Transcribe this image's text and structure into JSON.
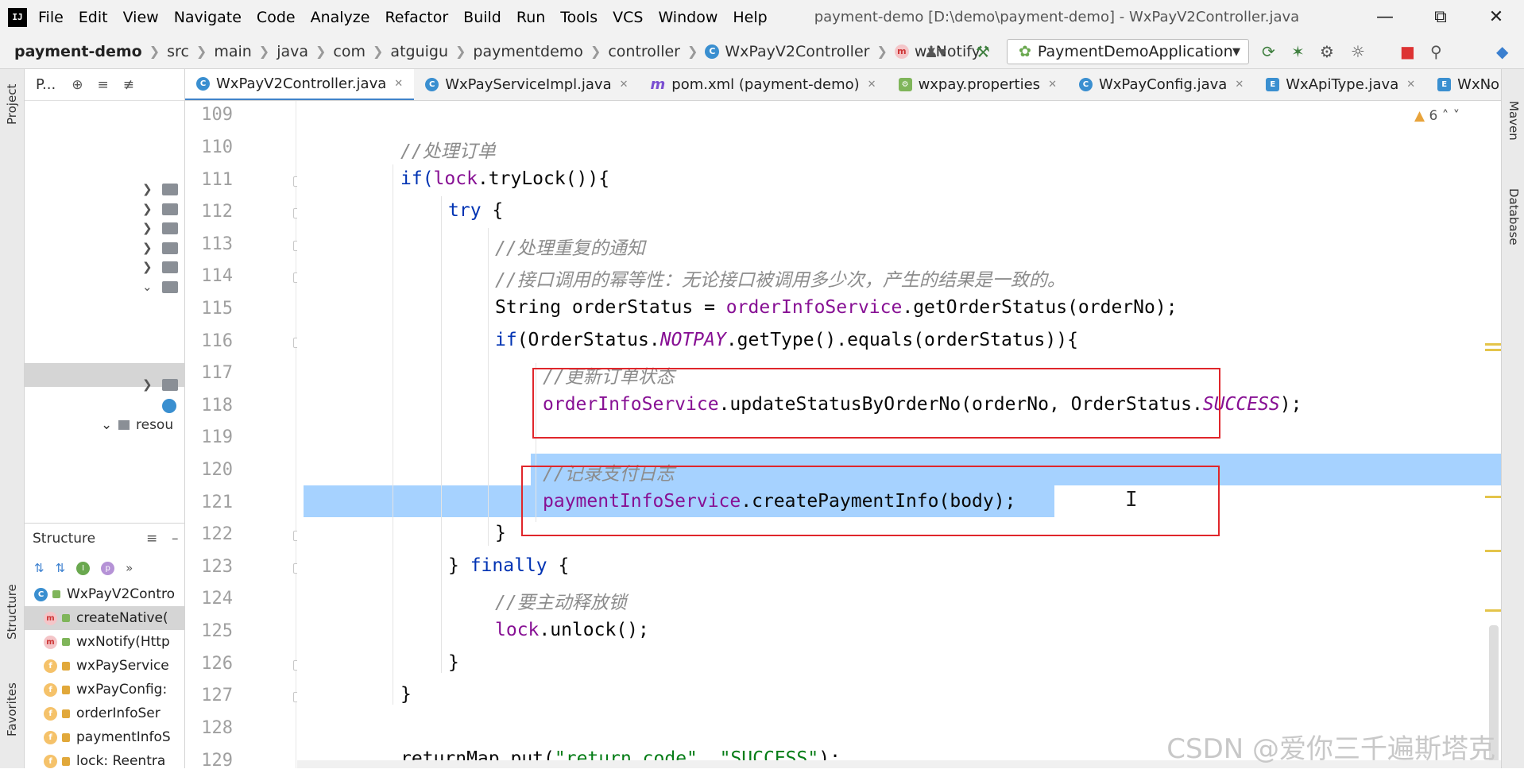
{
  "app": {
    "logo": "IJ",
    "menu": [
      "File",
      "Edit",
      "View",
      "Navigate",
      "Code",
      "Analyze",
      "Refactor",
      "Build",
      "Run",
      "Tools",
      "VCS",
      "Window",
      "Help"
    ],
    "title": "payment-demo [D:\\demo\\payment-demo] - WxPayV2Controller.java"
  },
  "breadcrumb": [
    "payment-demo",
    "src",
    "main",
    "java",
    "com",
    "atguigu",
    "paymentdemo",
    "controller",
    "WxPayV2Controller",
    "wxNotify"
  ],
  "run_config": "PaymentDemoApplication",
  "side": {
    "left_top": "Project",
    "left_mid": "Structure",
    "left_bot": "Favorites",
    "right_top": "Maven",
    "right_bot": "Database"
  },
  "project_panel": {
    "title": "P..."
  },
  "structure": {
    "title": "Structure",
    "items": [
      {
        "kind": "c",
        "label": "WxPayV2Contro"
      },
      {
        "kind": "m",
        "label": "createNative("
      },
      {
        "kind": "m",
        "label": "wxNotify(Http"
      },
      {
        "kind": "f",
        "label": "wxPayService"
      },
      {
        "kind": "f",
        "label": "wxPayConfig:"
      },
      {
        "kind": "f",
        "label": "orderInfoSer"
      },
      {
        "kind": "f",
        "label": "paymentInfoS"
      },
      {
        "kind": "f",
        "label": "lock: Reentra"
      }
    ]
  },
  "tree_partial": "resou",
  "tabs": [
    {
      "icon": "c",
      "label": "WxPayV2Controller.java",
      "active": true
    },
    {
      "icon": "c",
      "label": "WxPayServiceImpl.java",
      "active": false
    },
    {
      "icon": "m",
      "label": "pom.xml (payment-demo)",
      "active": false
    },
    {
      "icon": "p",
      "label": "wxpay.properties",
      "active": false
    },
    {
      "icon": "c",
      "label": "WxPayConfig.java",
      "active": false
    },
    {
      "icon": "e",
      "label": "WxApiType.java",
      "active": false
    },
    {
      "icon": "e",
      "label": "WxNo",
      "active": false
    }
  ],
  "warnings": "6",
  "line_numbers": [
    "109",
    "110",
    "111",
    "112",
    "113",
    "114",
    "115",
    "116",
    "117",
    "118",
    "119",
    "120",
    "121",
    "122",
    "123",
    "124",
    "125",
    "126",
    "127",
    "128",
    "129"
  ],
  "code": {
    "l110": "//处理订单",
    "l111_a": "if(",
    "l111_b": "lock",
    "l111_c": ".tryLock()){",
    "l112_a": "try",
    "l112_b": " {",
    "l113": "//处理重复的通知",
    "l114": "//接口调用的幂等性：无论接口被调用多少次，产生的结果是一致的。",
    "l115_a": "String orderStatus = ",
    "l115_b": "orderInfoService",
    "l115_c": ".getOrderStatus(orderNo);",
    "l116_a": "if",
    "l116_b": "(OrderStatus.",
    "l116_c": "NOTPAY",
    "l116_d": ".getType().equals(orderStatus)){",
    "l117": "//更新订单状态",
    "l118_a": "orderInfoService",
    "l118_b": ".updateStatusByOrderNo(orderNo, OrderStatus.",
    "l118_c": "SUCCESS",
    "l118_d": ");",
    "l120": "//记录支付日志",
    "l121_a": "paymentInfoService",
    "l121_b": ".createPaymentInfo(body);",
    "l122": "}",
    "l123_a": "} ",
    "l123_b": "finally",
    "l123_c": " {",
    "l124": "//要主动释放锁",
    "l125_a": "lock",
    "l125_b": ".unlock();",
    "l126": "}",
    "l127": "}",
    "l129_a": "returnMap.put(",
    "l129_b": "\"return_code\"",
    "l129_c": ", ",
    "l129_d": "\"SUCCESS\"",
    "l129_e": ");"
  },
  "watermark": "CSDN @爱你三千遍斯塔克",
  "colors": {
    "accent": "#4083c9",
    "selection": "#a6d2ff",
    "annotation": "#e0262b"
  }
}
